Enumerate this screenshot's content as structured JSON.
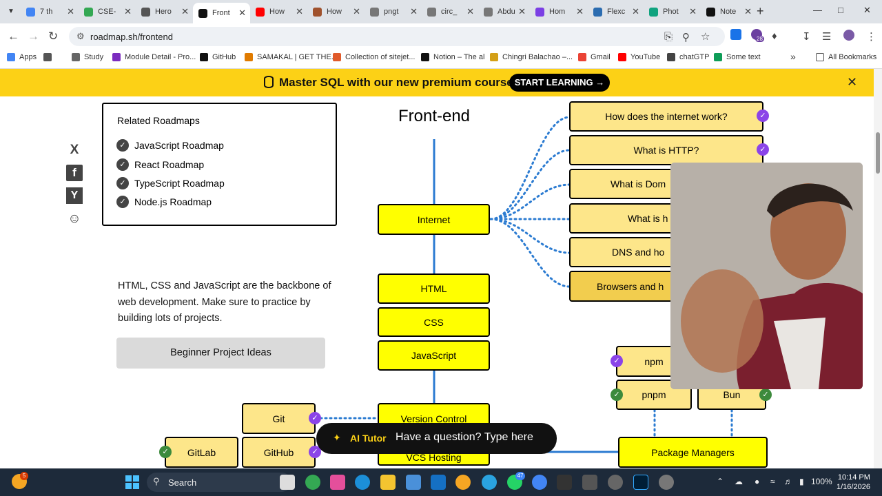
{
  "browser": {
    "tabs": [
      {
        "label": "7 th",
        "color": "#4285f4"
      },
      {
        "label": "CSE-",
        "color": "#34a853"
      },
      {
        "label": "Hero",
        "color": "#555555"
      },
      {
        "label": "Front",
        "color": "#111111",
        "active": true
      },
      {
        "label": "How",
        "color": "#ff0000"
      },
      {
        "label": "How",
        "color": "#a0522d"
      },
      {
        "label": "pngt",
        "color": "#777777"
      },
      {
        "label": "circ_",
        "color": "#777777"
      },
      {
        "label": "Abdu",
        "color": "#777777"
      },
      {
        "label": "Hom",
        "color": "#7b3fe4"
      },
      {
        "label": "Flexc",
        "color": "#2b6cb0"
      },
      {
        "label": "Phot",
        "color": "#10a37f"
      },
      {
        "label": "Note",
        "color": "#111111"
      }
    ],
    "url": "roadmap.sh/frontend",
    "extension_badge": "28"
  },
  "bookmarks": [
    {
      "label": "Apps",
      "color": "#4285f4"
    },
    {
      "label": "",
      "color": "#555555"
    },
    {
      "label": "Study",
      "color": "#666666"
    },
    {
      "label": "Module Detail - Pro...",
      "color": "#7b2cbf"
    },
    {
      "label": "GitHub",
      "color": "#111111"
    },
    {
      "label": "SAMAKAL | GET THE...",
      "color": "#e07b00"
    },
    {
      "label": "Collection of sitejet...",
      "color": "#e05a2b"
    },
    {
      "label": "Notion – The al",
      "color": "#111111"
    },
    {
      "label": "Chingri Balachao –...",
      "color": "#d4a017"
    },
    {
      "label": "Gmail",
      "color": "#ea4335"
    },
    {
      "label": "YouTube",
      "color": "#ff0000"
    },
    {
      "label": "chatGTP",
      "color": "#444444"
    },
    {
      "label": "Some text",
      "color": "#0f9d58"
    }
  ],
  "bookmarks_overflow": "»",
  "all_bookmarks": "All Bookmarks",
  "banner": {
    "text": "Master SQL with our new premium course",
    "cta": "START LEARNING →",
    "close": "✕"
  },
  "share": [
    "X",
    "f",
    "Y",
    "☺"
  ],
  "related": {
    "title": "Related Roadmaps",
    "items": [
      "JavaScript Roadmap",
      "React Roadmap",
      "TypeScript Roadmap",
      "Node.js Roadmap"
    ]
  },
  "intro": {
    "text": "HTML, CSS and JavaScript are the backbone of web development. Make sure to practice by building lots of projects.",
    "button": "Beginner Project Ideas"
  },
  "roadmap": {
    "title": "Front-end",
    "main_nodes": {
      "internet": "Internet",
      "html": "HTML",
      "css": "CSS",
      "javascript": "JavaScript",
      "version_control": "Version Control",
      "vcs_hosting": "VCS Hosting",
      "package_managers": "Package Managers"
    },
    "internet_topics": [
      "How does the internet work?",
      "What is HTTP?",
      "What is Dom",
      "What is h",
      "DNS and ho",
      "Browsers and h"
    ],
    "vcs_nodes": {
      "git": "Git",
      "gitlab": "GitLab",
      "github": "GitHub"
    },
    "pkg_nodes": {
      "npm": "npm",
      "pnpm": "pnpm",
      "bun": "Bun"
    }
  },
  "ai_tutor": {
    "label": "AI Tutor",
    "question": "Have a question? Type here"
  },
  "taskbar": {
    "search": "Search",
    "weather_badge": "5",
    "whatsapp_badge": "47",
    "battery": "100%",
    "time": "10:14 PM",
    "date": "1/16/2026"
  },
  "colors": {
    "banner": "#fcd116",
    "node_yellow": "#ffff00",
    "node_pale": "#fde68a",
    "check_purple": "#8b44e8",
    "check_green": "#3c8a3c",
    "edge_blue": "#2b7bd1"
  }
}
